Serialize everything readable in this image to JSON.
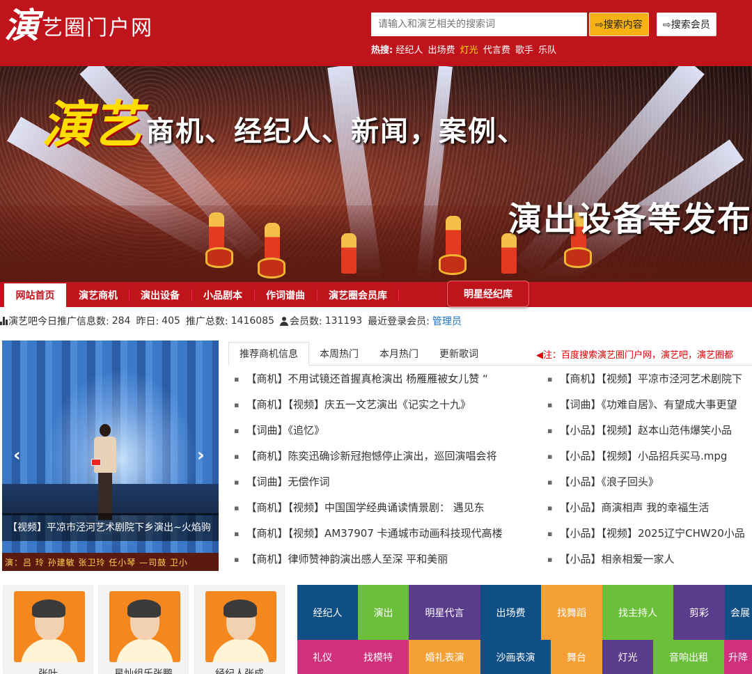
{
  "header": {
    "logo_big": "演",
    "logo_small": "艺圈门户网",
    "search_placeholder": "请输入和演艺相关的搜索词",
    "btn_content": "⇨搜索内容",
    "btn_member": "⇨搜索会员",
    "hot_label": "热搜:",
    "hot_items": [
      {
        "text": "经纪人",
        "highlight": false
      },
      {
        "text": "出场费",
        "highlight": false
      },
      {
        "text": "灯光",
        "highlight": true
      },
      {
        "text": "代言费",
        "highlight": false
      },
      {
        "text": "歌手",
        "highlight": false
      },
      {
        "text": "乐队",
        "highlight": false
      }
    ]
  },
  "banner": {
    "big": "演艺",
    "text": "商机、经纪人、新闻，案例、",
    "sub": "演出设备等发布平"
  },
  "nav": {
    "items": [
      "网站首页",
      "演艺商机",
      "演出设备",
      "小品剧本",
      "作词谱曲",
      "演艺圈会员库"
    ],
    "star": "明星经纪库"
  },
  "stats": {
    "today_label": "演艺吧今日推广信息数:",
    "today": "284",
    "yesterday_label": "昨日:",
    "yesterday": "405",
    "total_label": "推广总数:",
    "total": "1416085",
    "members_label": "会员数:",
    "members": "131193",
    "recent_label": "最近登录会员:",
    "recent": "管理员"
  },
  "slideshow": {
    "caption": "【视频】平凉市泾河艺术剧院下乡演出~火焰驹",
    "credits": "演：吕 玲 孙建敏 张卫玲 任小琴 —司鼓 卫小",
    "prev": "‹",
    "next": "›"
  },
  "tabs": [
    "推荐商机信息",
    "本周热门",
    "本月热门",
    "更新歌词"
  ],
  "notice": "◀注：百度搜索演艺圈门户网，演艺吧，演艺圈都",
  "list_left": [
    "【商机】不用试镜还首握真枪演出 杨雁雁被女儿赞 “",
    "【商机】【视频】庆五一文艺演出《记实之十九》",
    "【词曲】《追忆》",
    "【商机】陈奕迅确诊新冠抱憾停止演出，巡回演唱会将",
    "【词曲】无偿作词",
    "【商机】【视频】中国国学经典诵读情景剧： 遇见东",
    "【商机】【视频】AM37907 卡通城市动画科技现代高楼",
    "【商机】律师赞神韵演出感人至深 平和美丽"
  ],
  "list_right": [
    "【商机】【视频】平凉市泾河艺术剧院下",
    "【词曲】《功难自居》、有望成大事更望",
    "【小品】【视频】赵本山范伟爆笑小品",
    "【小品】【视频】小品招兵买马.mpg",
    "【小品】《浪子回头》",
    "【小品】商演相声 我的幸福生活",
    "【小品】【视频】2025辽宁CHW20小品",
    "【小品】相亲相爱一家人"
  ],
  "members": [
    "张叶",
    "星灿组乐张鹏",
    "经纪人张成"
  ],
  "tags_row1": [
    {
      "text": "经纪人",
      "color": "#104f86"
    },
    {
      "text": "演出",
      "color": "#6cbf3a"
    },
    {
      "text": "明星代言",
      "color": "#5b3c8c"
    },
    {
      "text": "出场费",
      "color": "#104f86"
    },
    {
      "text": "找舞蹈",
      "color": "#f5a034"
    },
    {
      "text": "找主持人",
      "color": "#6cbf3a"
    },
    {
      "text": "剪彩",
      "color": "#5b3c8c"
    },
    {
      "text": "会展",
      "color": "#104f86"
    }
  ],
  "tags_row2": [
    {
      "text": "礼仪",
      "color": "#d1307d"
    },
    {
      "text": "找模特",
      "color": "#d1307d"
    },
    {
      "text": "婚礼表演",
      "color": "#f5a034"
    },
    {
      "text": "沙画表演",
      "color": "#104f86"
    },
    {
      "text": "舞台",
      "color": "#f5a034"
    },
    {
      "text": "灯光",
      "color": "#5b3c8c"
    },
    {
      "text": "音响出租",
      "color": "#6cbf3a"
    },
    {
      "text": "升降",
      "color": "#d1307d"
    }
  ]
}
